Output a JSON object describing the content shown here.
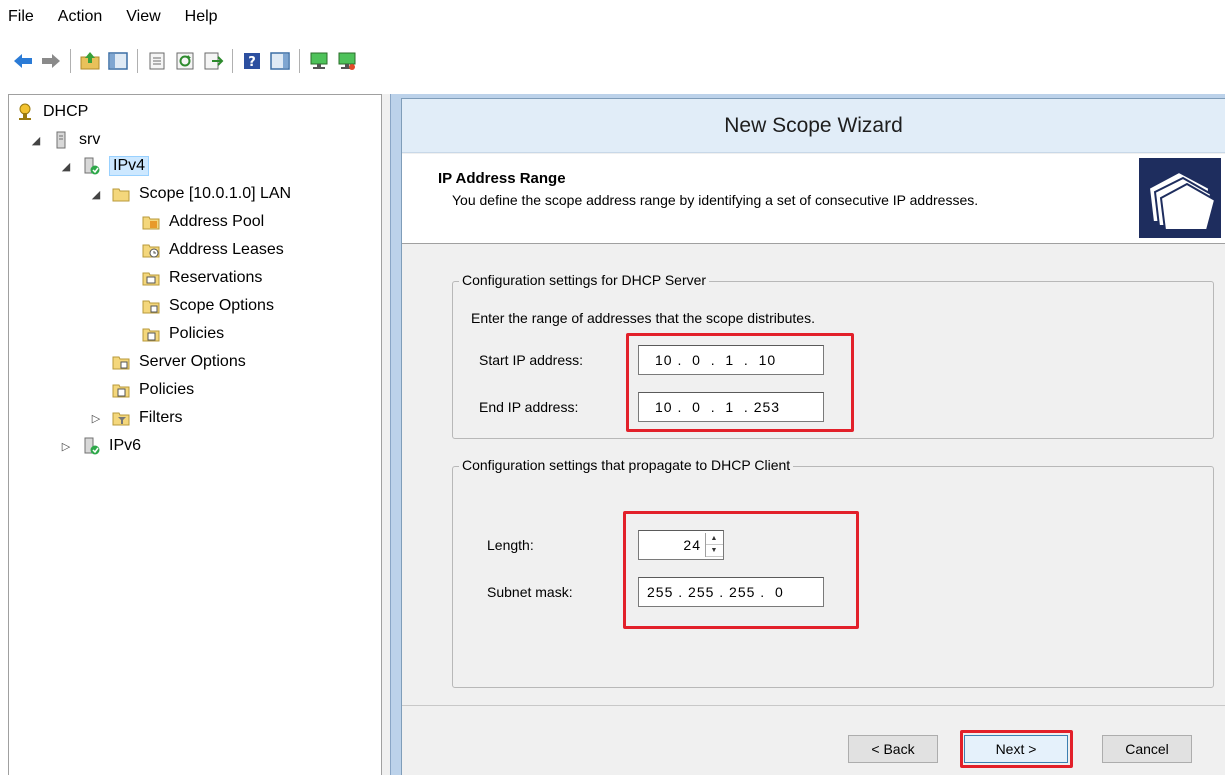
{
  "menu": [
    "File",
    "Action",
    "View",
    "Help"
  ],
  "toolbar": {
    "icons": [
      "back-arrow-icon",
      "forward-arrow-icon",
      "up-folder-icon",
      "show-hide-console-tree-icon",
      "properties-icon",
      "refresh-icon",
      "export-list-icon",
      "help-icon",
      "show-hide-action-pane-icon",
      "computer-icon",
      "computer-network-icon"
    ]
  },
  "tree": {
    "root": "DHCP",
    "server": "srv",
    "ipv4": "IPv4",
    "scope": "Scope [10.0.1.0] LAN",
    "scope_children": [
      "Address Pool",
      "Address Leases",
      "Reservations",
      "Scope Options",
      "Policies"
    ],
    "server_options": "Server Options",
    "policies": "Policies",
    "filters": "Filters",
    "ipv6": "IPv6"
  },
  "wizard": {
    "title": "New Scope Wizard",
    "header_title": "IP Address Range",
    "header_desc": "You define the scope address range by identifying a set of consecutive IP addresses.",
    "server_group": {
      "legend": "Configuration settings for DHCP Server",
      "instruction": "Enter the range of addresses that the scope distributes.",
      "start_label": "Start IP address:",
      "start_value": "10 .  0  .  1  .  10",
      "end_label": "End IP address:",
      "end_value": "10 .  0  .  1  . 253"
    },
    "client_group": {
      "legend": "Configuration settings that propagate to DHCP Client",
      "length_label": "Length:",
      "length_value": "24",
      "mask_label": "Subnet mask:",
      "mask_value": "255 . 255 . 255 .  0"
    },
    "buttons": {
      "back": "< Back",
      "next": "Next >",
      "cancel": "Cancel"
    }
  },
  "colors": {
    "highlight_red": "#e2202a",
    "wizard_title_bg": "#e1edf8",
    "tree_selection": "#cde8ff"
  }
}
